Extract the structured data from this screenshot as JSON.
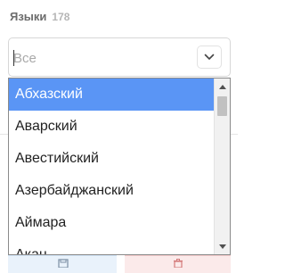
{
  "header": {
    "label": "Языки",
    "count": "178"
  },
  "select": {
    "placeholder": "Все",
    "value": ""
  },
  "dropdown": {
    "options": [
      {
        "label": "Абхазский",
        "selected": true
      },
      {
        "label": "Аварский",
        "selected": false
      },
      {
        "label": "Авестийский",
        "selected": false
      },
      {
        "label": "Азербайджанский",
        "selected": false
      },
      {
        "label": "Аймара",
        "selected": false
      },
      {
        "label": "Акан",
        "selected": false
      }
    ]
  },
  "colors": {
    "selected_bg": "#5a95f5",
    "header_text": "#6c6c6c",
    "count_text": "#b6b6b6"
  },
  "icons": {
    "chevron": "chevron-down-icon",
    "scroll_up": "scroll-up-arrow-icon",
    "scroll_down": "scroll-down-arrow-icon",
    "save": "save-icon",
    "delete": "trash-icon"
  }
}
